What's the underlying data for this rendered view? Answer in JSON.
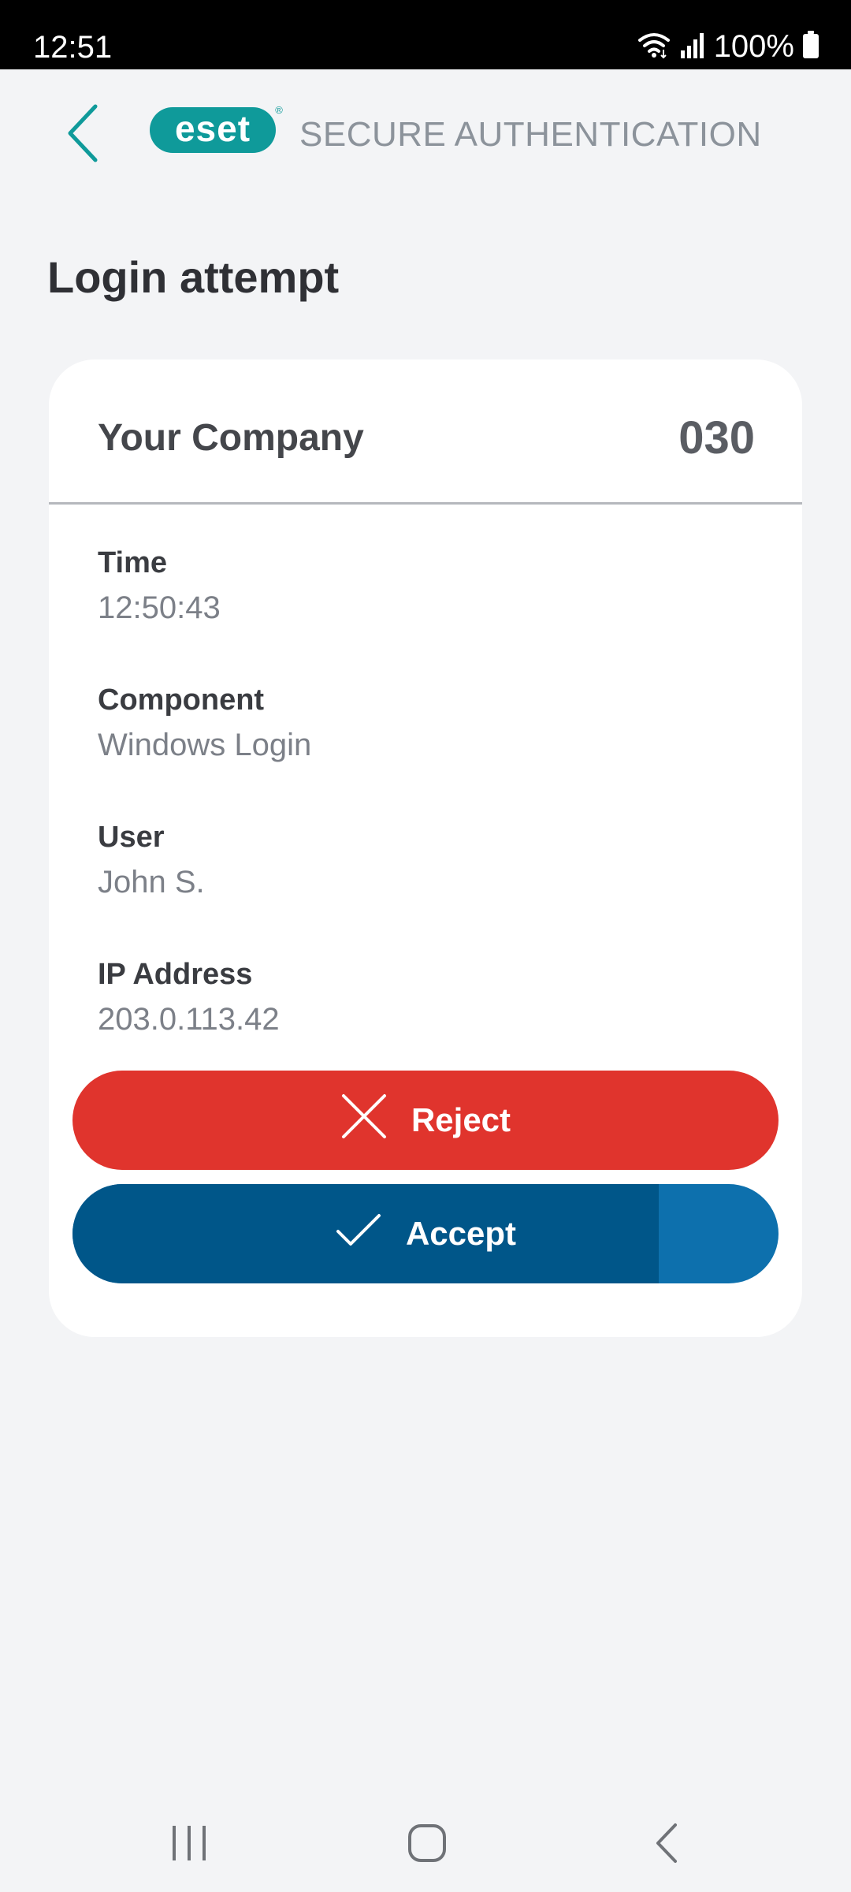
{
  "status_bar": {
    "time": "12:51",
    "battery": "100%",
    "icons": [
      "wifi-icon",
      "signal-icon",
      "battery-icon"
    ]
  },
  "header": {
    "logo_text": "eset",
    "logo_registered": "®",
    "subtitle": "SECURE AUTHENTICATION",
    "back_icon": "chevron-left-icon"
  },
  "page": {
    "title": "Login attempt"
  },
  "card": {
    "company": "Your Company",
    "code": "030",
    "fields": [
      {
        "label": "Time",
        "value": "12:50:43"
      },
      {
        "label": "Component",
        "value": "Windows Login"
      },
      {
        "label": "User",
        "value": "John S."
      },
      {
        "label": "IP Address",
        "value": "203.0.113.42"
      }
    ]
  },
  "actions": {
    "reject_label": "Reject",
    "accept_label": "Accept",
    "accept_timeout_progress": 0.83
  },
  "colors": {
    "accent_teal": "#0f9a9a",
    "reject": "#e0342d",
    "accept": "#005689",
    "accept_remaining": "#0d70ad"
  },
  "nav": {
    "icons": [
      "recent-apps-icon",
      "home-icon",
      "back-icon"
    ]
  }
}
